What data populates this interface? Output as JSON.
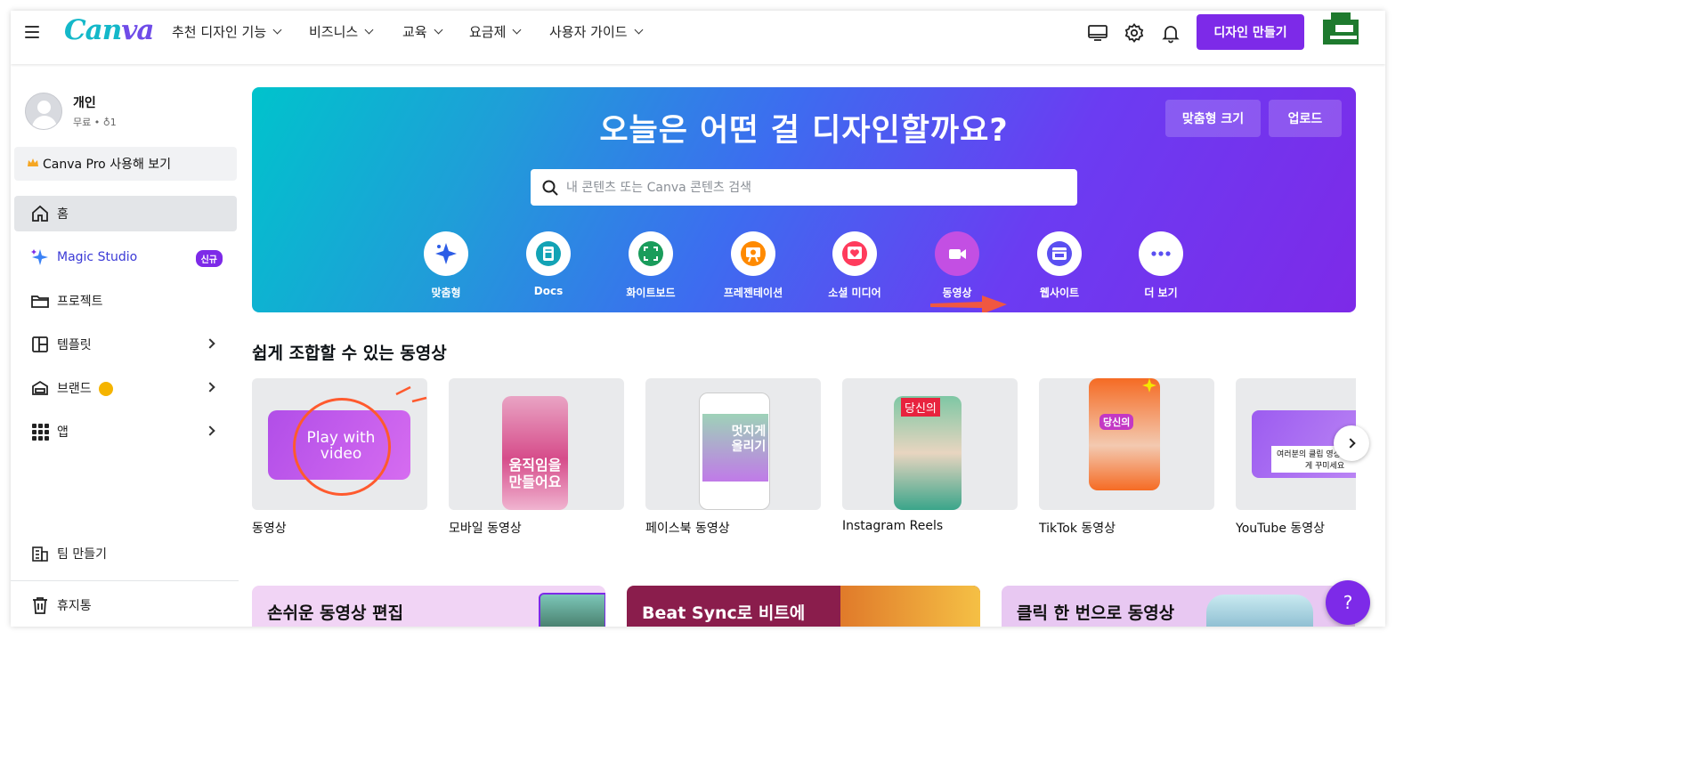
{
  "app": {
    "logo_text": "Canva"
  },
  "nav": {
    "items": [
      {
        "label": "추천 디자인 기능"
      },
      {
        "label": "비즈니스"
      },
      {
        "label": "교육"
      },
      {
        "label": "요금제"
      },
      {
        "label": "사용자 가이드"
      }
    ],
    "create_button": "디자인 만들기",
    "icons": [
      "desktop-icon",
      "gear-icon",
      "bell-icon"
    ]
  },
  "sidebar": {
    "profile": {
      "name": "개인",
      "sub": "무료 • ♁1"
    },
    "pro_button": "Canva Pro 사용해 보기",
    "items": [
      {
        "label": "홈",
        "icon": "home-icon",
        "active": true
      },
      {
        "label": "Magic Studio",
        "icon": "sparkle-icon",
        "badge": "신규"
      },
      {
        "label": "프로젝트",
        "icon": "folder-icon"
      },
      {
        "label": "템플릿",
        "icon": "template-icon"
      },
      {
        "label": "브랜드",
        "icon": "brand-icon"
      },
      {
        "label": "앱",
        "icon": "apps-grid-icon"
      }
    ],
    "bottom_items": [
      {
        "label": "팀 만들기",
        "icon": "team-icon"
      },
      {
        "label": "휴지통",
        "icon": "trash-icon"
      }
    ]
  },
  "hero": {
    "title": "오늘은 어떤 걸 디자인할까요?",
    "custom_size_button": "맞춤형 크기",
    "upload_button": "업로드",
    "search_placeholder": "내 콘텐츠 또는 Canva 콘텐츠 검색",
    "categories": [
      {
        "label": "맞춤형",
        "icon": "sparkle-icon",
        "color": "#2d5de6"
      },
      {
        "label": "Docs",
        "icon": "docs-icon",
        "color": "#13a3b5"
      },
      {
        "label": "화이트보드",
        "icon": "whiteboard-icon",
        "color": "#1a9c5b"
      },
      {
        "label": "프레젠테이션",
        "icon": "presentation-icon",
        "color": "#ff8a00"
      },
      {
        "label": "소셜 미디어",
        "icon": "heart-icon",
        "color": "#ff3b5c"
      },
      {
        "label": "동영상",
        "icon": "video-camera-icon",
        "color": "#c34fe3"
      },
      {
        "label": "웹사이트",
        "icon": "website-icon",
        "color": "#5a4ff1"
      },
      {
        "label": "더 보기",
        "icon": "more-icon",
        "color": "#5a4ff1"
      }
    ]
  },
  "video_section": {
    "title": "쉽게 조합할 수 있는 동영상",
    "cards": [
      {
        "label": "동영상",
        "thumb_text": "Play with video"
      },
      {
        "label": "모바일 동영상",
        "thumb_text": "움직임을 만들어요"
      },
      {
        "label": "페이스북 동영상",
        "thumb_text": "멋지게 올리기"
      },
      {
        "label": "Instagram Reels",
        "thumb_text": "당신의"
      },
      {
        "label": "TikTok 동영상",
        "thumb_text": "당신의"
      },
      {
        "label": "YouTube 동영상",
        "thumb_text": "여러분의 클립 영상을 자유롭게 꾸미세요"
      }
    ]
  },
  "promos": [
    {
      "text": "손쉬운 동영상 편집"
    },
    {
      "text": "Beat Sync로 비트에"
    },
    {
      "text": "클릭 한 번으로 동영상"
    }
  ],
  "help": {
    "label": "?"
  },
  "colors": {
    "brand_purple": "#7d2ae8",
    "teal": "#00c3cc"
  }
}
